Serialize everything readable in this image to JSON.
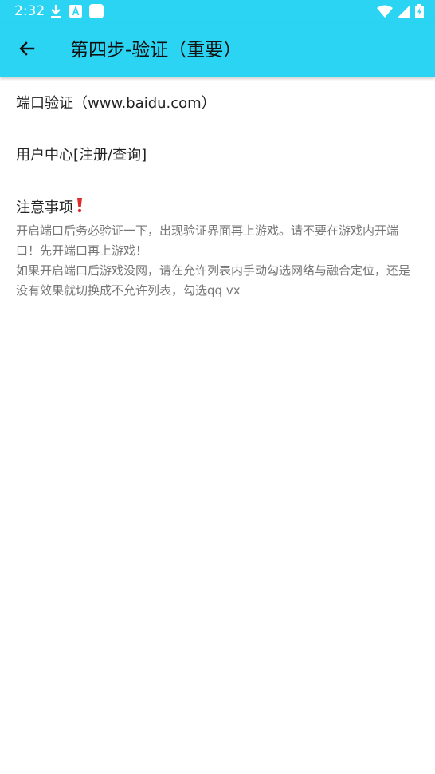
{
  "status_bar": {
    "time": "2:32",
    "left_icons": [
      "download-icon",
      "font-app-icon",
      "app-square-icon"
    ],
    "right_icons": [
      "wifi-icon",
      "signal-icon",
      "battery-charging-icon"
    ]
  },
  "app_bar": {
    "back_icon": "arrow-left-icon",
    "title": "第四步-验证（重要）",
    "background": "#2ad4f2"
  },
  "items": [
    {
      "label": "端口验证（www.baidu.com）"
    },
    {
      "label": "用户中心[注册/查询]"
    }
  ],
  "notice": {
    "title": "注意事项",
    "title_icon": "exclamation-icon",
    "icon_color": "#e02a2a",
    "paragraphs": [
      "开启端口后务必验证一下，出现验证界面再上游戏。请不要在游戏内开端口！先开端口再上游戏！",
      "如果开启端口后游戏没网，请在允许列表内手动勾选网络与融合定位，还是没有效果就切换成不允许列表，勾选qq vx"
    ]
  }
}
